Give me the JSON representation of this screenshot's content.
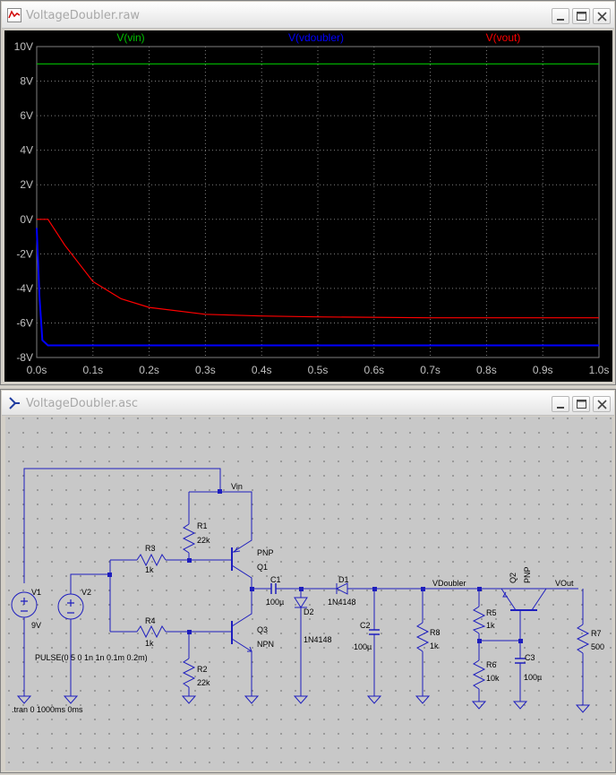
{
  "waveform_window": {
    "title": "VoltageDoubler.raw",
    "traces": [
      {
        "name": "V(vin)",
        "color": "#00c000"
      },
      {
        "name": "V(vdoubler)",
        "color": "#0000ff"
      },
      {
        "name": "V(vout)",
        "color": "#ff0000"
      }
    ],
    "y_ticks": [
      "10V",
      "8V",
      "6V",
      "4V",
      "2V",
      "0V",
      "-2V",
      "-4V",
      "-6V",
      "-8V"
    ],
    "x_ticks": [
      "0.0s",
      "0.1s",
      "0.2s",
      "0.3s",
      "0.4s",
      "0.5s",
      "0.6s",
      "0.7s",
      "0.8s",
      "0.9s",
      "1.0s"
    ]
  },
  "chart_data": {
    "type": "line",
    "xlabel": "",
    "ylabel": "",
    "xlim": [
      0,
      1.0
    ],
    "ylim": [
      -8,
      10
    ],
    "grid": true,
    "legend": "top",
    "series": [
      {
        "name": "V(vin)",
        "color": "#00c000",
        "x": [
          0,
          1.0
        ],
        "y": [
          9,
          9
        ]
      },
      {
        "name": "V(vdoubler)",
        "color": "#0000ff",
        "x": [
          0,
          0.005,
          0.01,
          0.02,
          1.0
        ],
        "y": [
          -0.5,
          -4.5,
          -7.0,
          -7.3,
          -7.3
        ]
      },
      {
        "name": "V(vout)",
        "color": "#ff0000",
        "x": [
          0,
          0.02,
          0.05,
          0.1,
          0.15,
          0.2,
          0.3,
          0.4,
          0.5,
          0.7,
          1.0
        ],
        "y": [
          0,
          0,
          -1.5,
          -3.6,
          -4.6,
          -5.1,
          -5.5,
          -5.6,
          -5.65,
          -5.7,
          -5.7
        ]
      }
    ]
  },
  "schematic_window": {
    "title": "VoltageDoubler.asc",
    "labels": {
      "vin": "Vin",
      "v1": "V1",
      "v1_val": "9V",
      "v2": "V2",
      "v2_val": "PULSE(0 5 0 1n 1n 0.1m 0.2m)",
      "r1": "R1",
      "r1_val": "22k",
      "r2": "R2",
      "r2_val": "22k",
      "r3": "R3",
      "r3_val": "1k",
      "r4": "R4",
      "r4_val": "1k",
      "q1": "Q1",
      "q1_type": "PNP",
      "q3": "Q3",
      "q3_type": "NPN",
      "c1": "C1",
      "c1_val": "100µ",
      "d1": "D1",
      "d1_val": "1N4148",
      "d2": "D2",
      "d2_val": "1N4148",
      "c2": "C2",
      "c2_val": "100µ",
      "r8": "R8",
      "r8_val": "1k",
      "vdoubler": "VDoubler",
      "r5": "R5",
      "r5_val": "1k",
      "r6": "R6",
      "r6_val": "10k",
      "q2": "Q2",
      "q2_type": "PNP",
      "c3": "C3",
      "c3_val": "100µ",
      "vout": "VOut",
      "r7": "R7",
      "r7_val": "500",
      "tran": ".tran 0 1000ms 0ms"
    }
  }
}
